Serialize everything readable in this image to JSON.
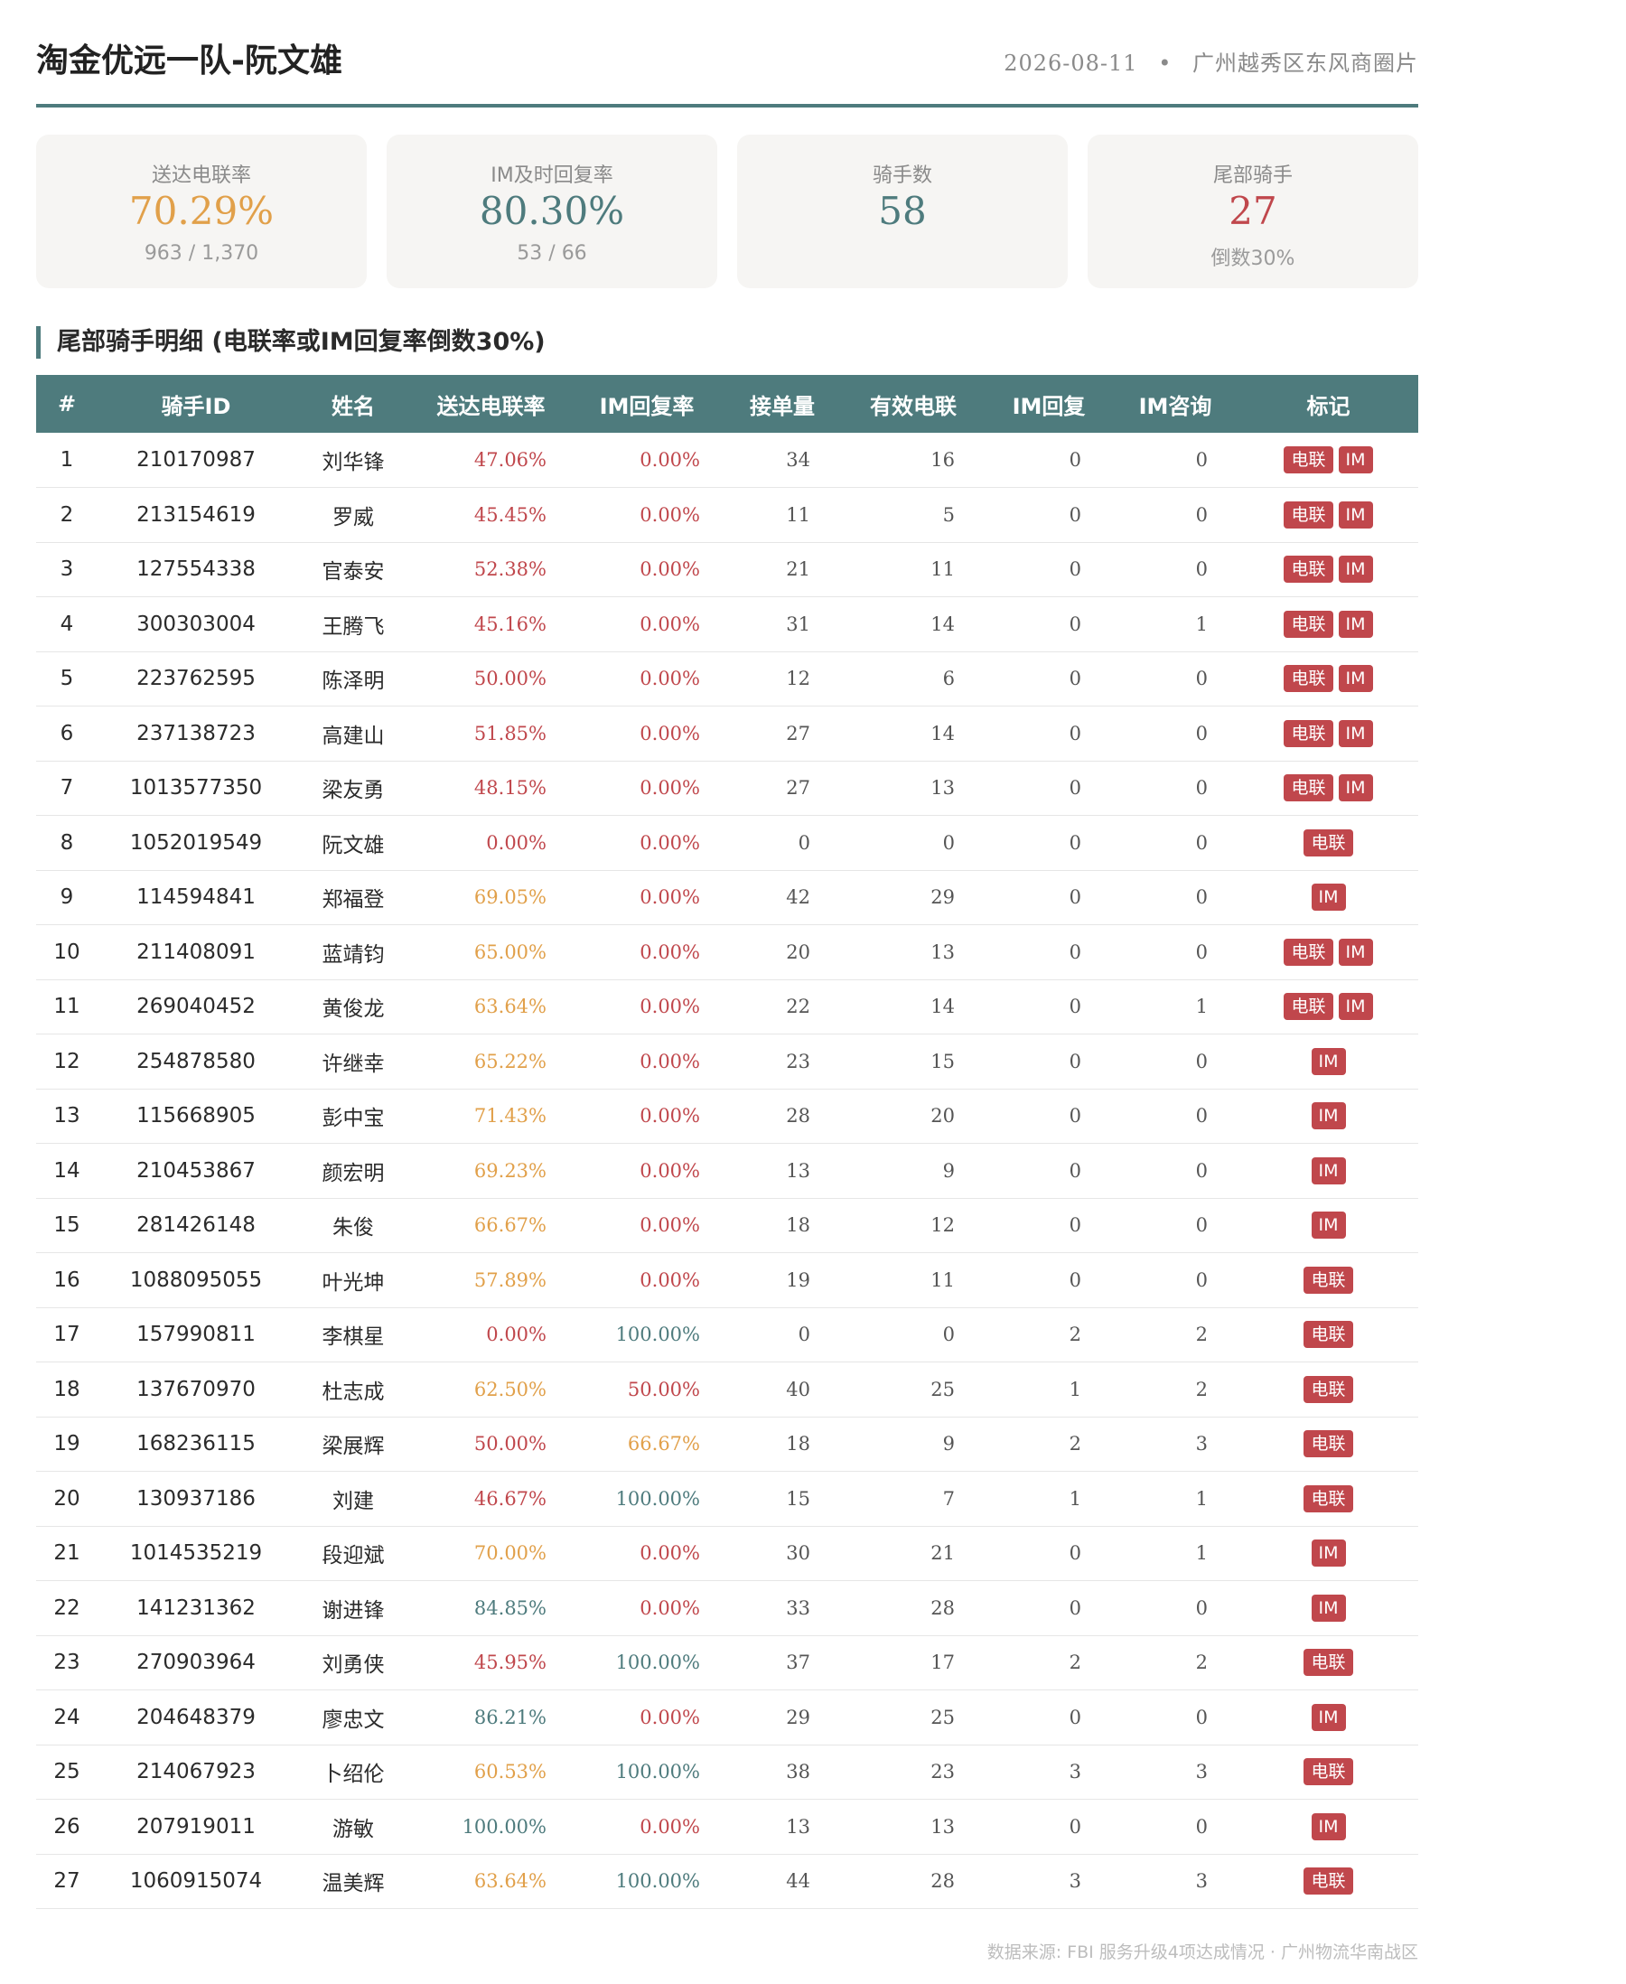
{
  "header": {
    "title": "淘金优远一队-阮文雄",
    "date": "2026-08-11",
    "separator": "•",
    "area": "广州越秀区东风商圈片"
  },
  "cards": [
    {
      "label": "送达电联率",
      "value": "70.29%",
      "sub": "963 / 1,370",
      "color": "#e1a04a"
    },
    {
      "label": "IM及时回复率",
      "value": "80.30%",
      "sub": "53 / 66",
      "color": "#4e7b7d"
    },
    {
      "label": "骑手数",
      "value": "58",
      "sub": "",
      "color": "#4e7b7d"
    },
    {
      "label": "尾部骑手",
      "value": "27",
      "sub": "倒数30%",
      "color": "#c0474c"
    }
  ],
  "section_title": "尾部骑手明细 (电联率或IM回复率倒数30%)",
  "table": {
    "columns": [
      "#",
      "骑手ID",
      "姓名",
      "送达电联率",
      "IM回复率",
      "接单量",
      "有效电联",
      "IM回复",
      "IM咨询",
      "标记"
    ],
    "rows": [
      [
        "1",
        "210170987",
        "刘华锋",
        "47.06%",
        "0.00%",
        "34",
        "16",
        "0",
        "0",
        [
          "电联",
          "IM"
        ]
      ],
      [
        "2",
        "213154619",
        "罗威",
        "45.45%",
        "0.00%",
        "11",
        "5",
        "0",
        "0",
        [
          "电联",
          "IM"
        ]
      ],
      [
        "3",
        "127554338",
        "官泰安",
        "52.38%",
        "0.00%",
        "21",
        "11",
        "0",
        "0",
        [
          "电联",
          "IM"
        ]
      ],
      [
        "4",
        "300303004",
        "王腾飞",
        "45.16%",
        "0.00%",
        "31",
        "14",
        "0",
        "1",
        [
          "电联",
          "IM"
        ]
      ],
      [
        "5",
        "223762595",
        "陈泽明",
        "50.00%",
        "0.00%",
        "12",
        "6",
        "0",
        "0",
        [
          "电联",
          "IM"
        ]
      ],
      [
        "6",
        "237138723",
        "高建山",
        "51.85%",
        "0.00%",
        "27",
        "14",
        "0",
        "0",
        [
          "电联",
          "IM"
        ]
      ],
      [
        "7",
        "1013577350",
        "梁友勇",
        "48.15%",
        "0.00%",
        "27",
        "13",
        "0",
        "0",
        [
          "电联",
          "IM"
        ]
      ],
      [
        "8",
        "1052019549",
        "阮文雄",
        "0.00%",
        "0.00%",
        "0",
        "0",
        "0",
        "0",
        [
          "电联"
        ]
      ],
      [
        "9",
        "114594841",
        "郑福登",
        "69.05%",
        "0.00%",
        "42",
        "29",
        "0",
        "0",
        [
          "IM"
        ]
      ],
      [
        "10",
        "211408091",
        "蓝靖钧",
        "65.00%",
        "0.00%",
        "20",
        "13",
        "0",
        "0",
        [
          "电联",
          "IM"
        ]
      ],
      [
        "11",
        "269040452",
        "黄俊龙",
        "63.64%",
        "0.00%",
        "22",
        "14",
        "0",
        "1",
        [
          "电联",
          "IM"
        ]
      ],
      [
        "12",
        "254878580",
        "许继幸",
        "65.22%",
        "0.00%",
        "23",
        "15",
        "0",
        "0",
        [
          "IM"
        ]
      ],
      [
        "13",
        "115668905",
        "彭中宝",
        "71.43%",
        "0.00%",
        "28",
        "20",
        "0",
        "0",
        [
          "IM"
        ]
      ],
      [
        "14",
        "210453867",
        "颜宏明",
        "69.23%",
        "0.00%",
        "13",
        "9",
        "0",
        "0",
        [
          "IM"
        ]
      ],
      [
        "15",
        "281426148",
        "朱俊",
        "66.67%",
        "0.00%",
        "18",
        "12",
        "0",
        "0",
        [
          "IM"
        ]
      ],
      [
        "16",
        "1088095055",
        "叶光坤",
        "57.89%",
        "0.00%",
        "19",
        "11",
        "0",
        "0",
        [
          "电联"
        ]
      ],
      [
        "17",
        "157990811",
        "李棋星",
        "0.00%",
        "100.00%",
        "0",
        "0",
        "2",
        "2",
        [
          "电联"
        ]
      ],
      [
        "18",
        "137670970",
        "杜志成",
        "62.50%",
        "50.00%",
        "40",
        "25",
        "1",
        "2",
        [
          "电联"
        ]
      ],
      [
        "19",
        "168236115",
        "梁展辉",
        "50.00%",
        "66.67%",
        "18",
        "9",
        "2",
        "3",
        [
          "电联"
        ]
      ],
      [
        "20",
        "130937186",
        "刘建",
        "46.67%",
        "100.00%",
        "15",
        "7",
        "1",
        "1",
        [
          "电联"
        ]
      ],
      [
        "21",
        "1014535219",
        "段迎斌",
        "70.00%",
        "0.00%",
        "30",
        "21",
        "0",
        "1",
        [
          "IM"
        ]
      ],
      [
        "22",
        "141231362",
        "谢进锋",
        "84.85%",
        "0.00%",
        "33",
        "28",
        "0",
        "0",
        [
          "IM"
        ]
      ],
      [
        "23",
        "270903964",
        "刘勇侠",
        "45.95%",
        "100.00%",
        "37",
        "17",
        "2",
        "2",
        [
          "电联"
        ]
      ],
      [
        "24",
        "204648379",
        "廖忠文",
        "86.21%",
        "0.00%",
        "29",
        "25",
        "0",
        "0",
        [
          "IM"
        ]
      ],
      [
        "25",
        "214067923",
        "卜绍伦",
        "60.53%",
        "100.00%",
        "38",
        "23",
        "3",
        "3",
        [
          "电联"
        ]
      ],
      [
        "26",
        "207919011",
        "游敏",
        "100.00%",
        "0.00%",
        "13",
        "13",
        "0",
        "0",
        [
          "IM"
        ]
      ],
      [
        "27",
        "1060915074",
        "温美辉",
        "63.64%",
        "100.00%",
        "44",
        "28",
        "3",
        "3",
        [
          "电联"
        ]
      ]
    ]
  },
  "rate_colors": {
    "low": "#c0474c",
    "mid": "#e1a04a",
    "high": "#4e7b7d"
  },
  "footer": "数据来源: FBI 服务升级4项达成情况 · 广州物流华南战区"
}
